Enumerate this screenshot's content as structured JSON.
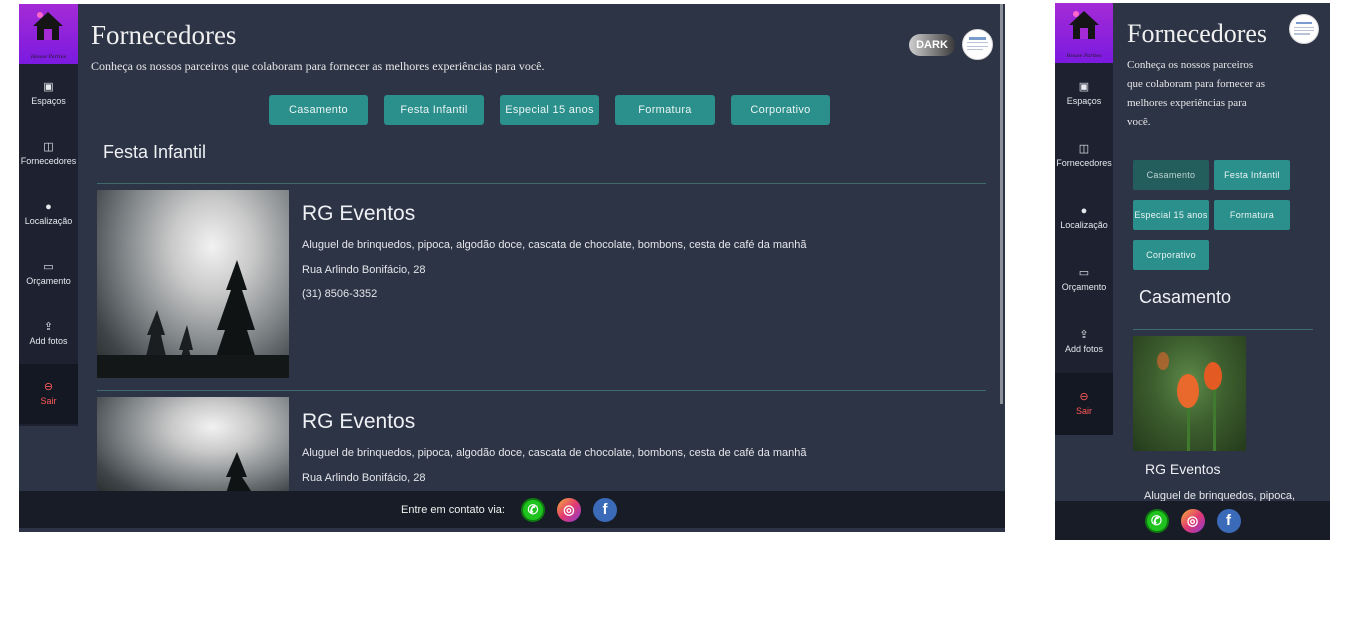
{
  "app": {
    "logo_text": "House Parties"
  },
  "sidebar": {
    "items": [
      {
        "label": "Espaços",
        "icon": "image-icon"
      },
      {
        "label": "Fornecedores",
        "icon": "store-icon"
      },
      {
        "label": "Localização",
        "icon": "map-pin-icon"
      },
      {
        "label": "Orçamento",
        "icon": "credit-card-icon"
      },
      {
        "label": "Add fotos",
        "icon": "upload-icon"
      },
      {
        "label": "Sair",
        "icon": "logout-icon"
      }
    ]
  },
  "header": {
    "title": "Fornecedores",
    "subtitle": "Conheça os nossos parceiros que colaboram para fornecer as melhores experiências para você.",
    "subtitle_lines": [
      "Conheça os nossos parceiros",
      "que colaboram para fornecer as",
      "melhores experiências para",
      "você."
    ],
    "dark_toggle": "DARK"
  },
  "categories": [
    "Casamento",
    "Festa Infantil",
    "Especial 15 anos",
    "Formatura",
    "Corporativo"
  ],
  "desktop": {
    "section_title": "Festa Infantil",
    "cards": [
      {
        "name": "RG Eventos",
        "description": "Aluguel de brinquedos, pipoca, algodão doce, cascata de chocolate, bombons, cesta de café da manhã",
        "address": "Rua Arlindo Bonifácio, 28",
        "phone": "(31) 8506-3352"
      },
      {
        "name": "RG Eventos",
        "description": "Aluguel de brinquedos, pipoca, algodão doce, cascata de chocolate, bombons, cesta de café da manhã",
        "address": "Rua Arlindo Bonifácio, 28"
      }
    ]
  },
  "mobile": {
    "section_title": "Casamento",
    "card": {
      "name": "RG Eventos",
      "description": "Aluguel de brinquedos, pipoca,"
    }
  },
  "footer": {
    "label": "Entre em contato via:"
  },
  "colors": {
    "sidebar": "#1e2230",
    "content": "#2d3446",
    "accent": "#2b8f8c",
    "logo": "#a42bd6",
    "exit": "#ff5a5a"
  }
}
